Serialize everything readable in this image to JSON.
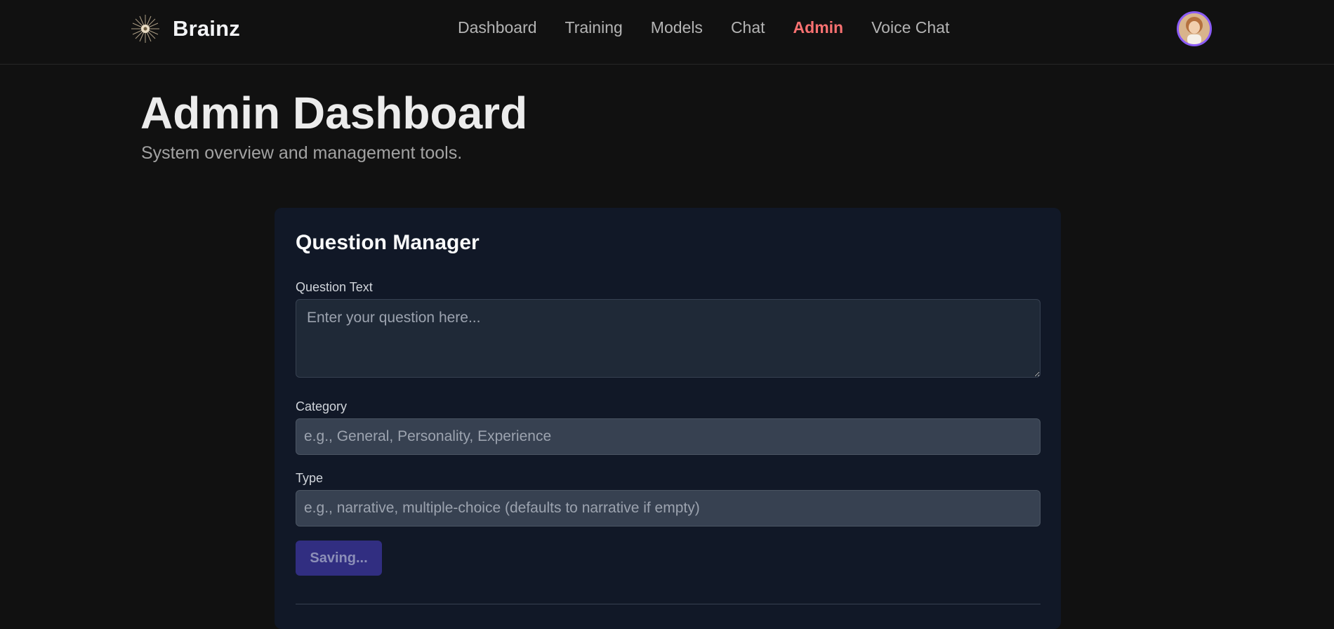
{
  "header": {
    "brand": "Brainz",
    "nav": [
      {
        "label": "Dashboard",
        "active": false
      },
      {
        "label": "Training",
        "active": false
      },
      {
        "label": "Models",
        "active": false
      },
      {
        "label": "Chat",
        "active": false
      },
      {
        "label": "Admin",
        "active": true
      },
      {
        "label": "Voice Chat",
        "active": false
      }
    ],
    "accent_color": "#f87171",
    "avatar_ring_color": "#8b5cf6"
  },
  "page": {
    "title": "Admin Dashboard",
    "subtitle": "System overview and management tools."
  },
  "question_manager": {
    "title": "Question Manager",
    "question_text": {
      "label": "Question Text",
      "value": "",
      "placeholder": "Enter your question here..."
    },
    "category": {
      "label": "Category",
      "value": "",
      "placeholder": "e.g., General, Personality, Experience"
    },
    "type": {
      "label": "Type",
      "value": "",
      "placeholder": "e.g., narrative, multiple-choice (defaults to narrative if empty)"
    },
    "save_button": {
      "label": "Saving...",
      "disabled": true
    }
  }
}
